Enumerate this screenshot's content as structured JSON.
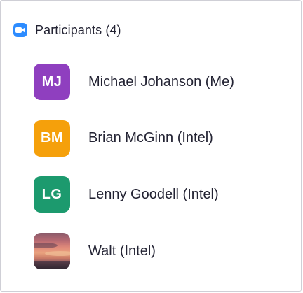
{
  "header": {
    "icon": "zoom-camera-icon",
    "title": "Participants (4)",
    "icon_color": "#2d8cff"
  },
  "participants": [
    {
      "initials": "MJ",
      "name": "Michael Johanson (Me)",
      "avatar_color": "#8f3fbf"
    },
    {
      "initials": "BM",
      "name": "Brian McGinn (Intel)",
      "avatar_color": "#f5a00b"
    },
    {
      "initials": "LG",
      "name": "Lenny Goodell (Intel)",
      "avatar_color": "#1c9a6e"
    },
    {
      "initials": "",
      "name": "Walt (Intel)",
      "avatar_color": "",
      "avatar_type": "photo"
    }
  ]
}
